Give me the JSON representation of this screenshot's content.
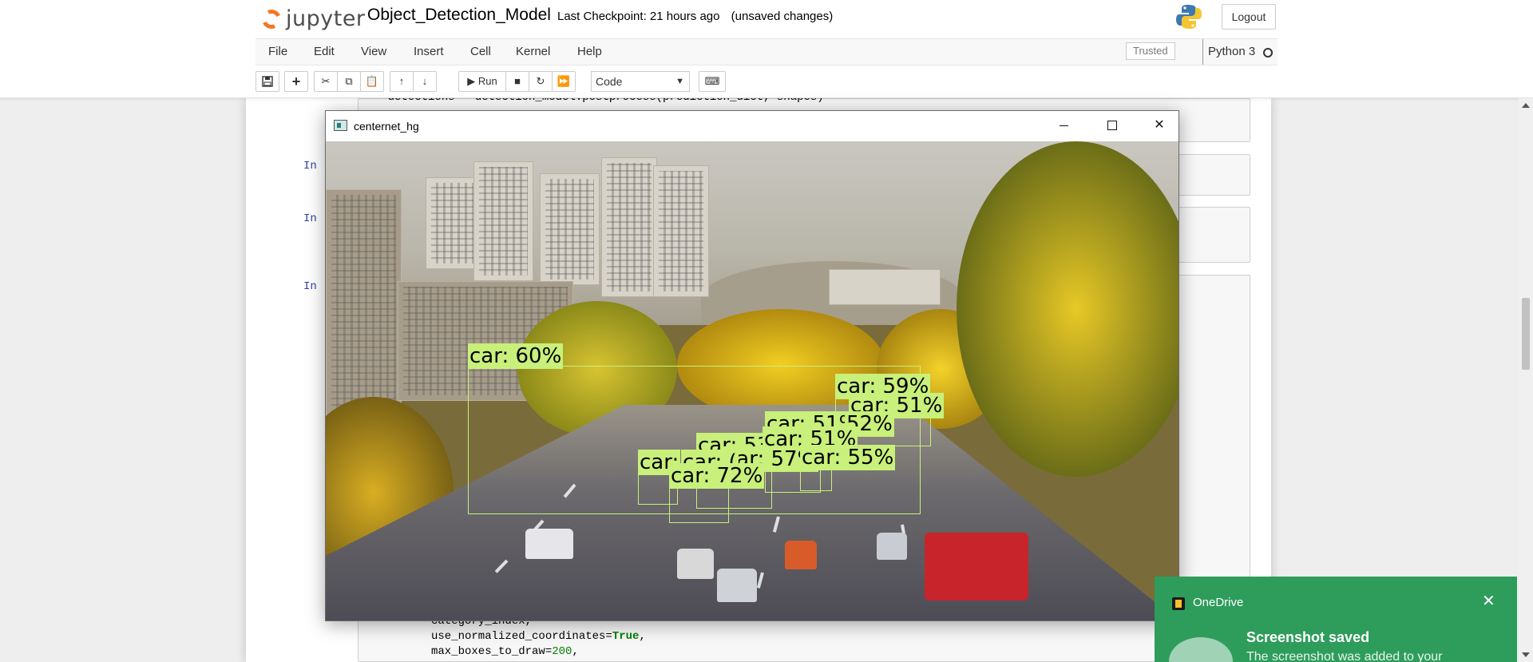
{
  "header": {
    "logo_text": "jupyter",
    "notebook_title": "Object_Detection_Model",
    "checkpoint": "Last Checkpoint: 21 hours ago",
    "save_status": "(unsaved changes)",
    "logout_label": "Logout"
  },
  "menu": {
    "items": [
      "File",
      "Edit",
      "View",
      "Insert",
      "Cell",
      "Kernel",
      "Help"
    ],
    "trusted_label": "Trusted",
    "kernel_name": "Python 3"
  },
  "toolbar": {
    "run_label": "Run",
    "cell_type": "Code",
    "icons": [
      "save-icon",
      "add-cell-icon",
      "cut-icon",
      "copy-icon",
      "paste-icon",
      "move-up-icon",
      "move-down-icon",
      "run-icon",
      "stop-icon",
      "restart-icon",
      "fast-forward-icon",
      "keyboard-icon"
    ]
  },
  "cells": {
    "code_top": "    detections = detection_model.postprocess(prediction_dict, shapes)",
    "prompts": [
      "In",
      "In",
      "In"
    ],
    "code_bottom": [
      "category_index,",
      "use_normalized_coordinates=",
      "max_boxes_to_draw="
    ],
    "code_bottom_values": [
      "",
      "True",
      "200"
    ],
    "code_bottom_tail": [
      "",
      ",",
      ","
    ]
  },
  "cv_window": {
    "title": "centernet_hg",
    "controls": [
      "minimize-icon",
      "maximize-icon",
      "close-icon"
    ],
    "detections": [
      "car: 60%",
      "car: 59%",
      "car: 51%",
      "car: 51%",
      "52%",
      "car: 53%",
      "car: 51%",
      "car: 57%",
      "car: 55%",
      "car: ",
      "car: (",
      "car: 72%"
    ]
  },
  "toast": {
    "app_name": "OneDrive",
    "title": "Screenshot saved",
    "body": "The screenshot was added to your"
  },
  "colors": {
    "jupyter_orange": "#f37726",
    "detection_label": "#c8f07a",
    "onedrive_green": "#2e9d5b",
    "prompt_blue": "#303f9f"
  }
}
